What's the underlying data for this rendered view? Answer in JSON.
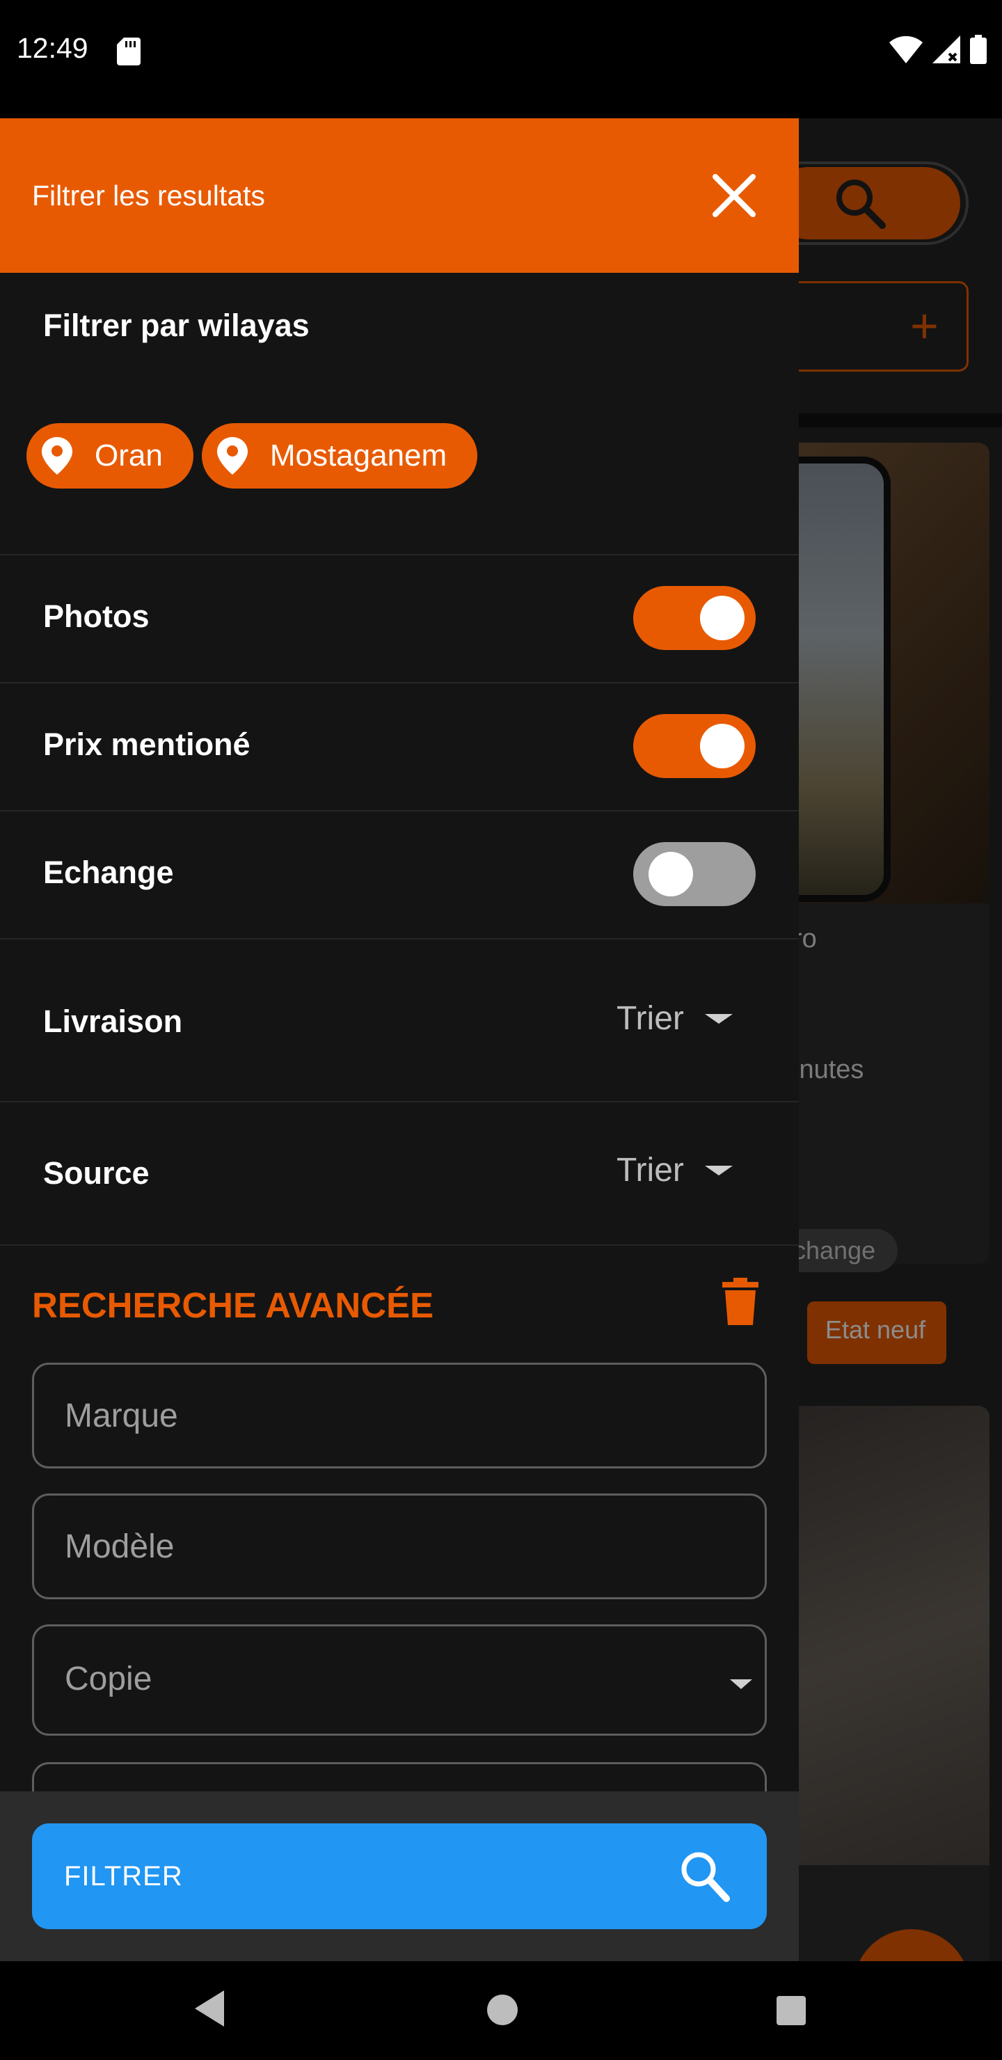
{
  "status_bar": {
    "time": "12:49"
  },
  "background": {
    "card_title_fragment": "ro",
    "time_fragment": "inutes",
    "chip_fragment": "change",
    "condition_badge": "Etat neuf",
    "ellipsis": ", ..."
  },
  "drawer": {
    "title": "Filtrer les resultats",
    "wilaya_heading": "Filtrer par wilayas",
    "wilayas": [
      "Oran",
      "Mostaganem"
    ],
    "toggles": [
      {
        "label": "Photos",
        "on": true
      },
      {
        "label": "Prix mentioné",
        "on": true
      },
      {
        "label": "Echange",
        "on": false
      }
    ],
    "sort_rows": [
      {
        "label": "Livraison",
        "value": "Trier"
      },
      {
        "label": "Source",
        "value": "Trier"
      }
    ],
    "advanced": {
      "title": "RECHERCHE AVANCÉE",
      "brand_placeholder": "Marque",
      "model_placeholder": "Modèle",
      "copy_select": "Copie"
    },
    "filter_button": "FILTRER"
  },
  "colors": {
    "accent": "#e85a02",
    "primary_button": "#2196f3",
    "drawer_bg": "#141414"
  },
  "icons": [
    "sd-card-icon",
    "wifi-icon",
    "signal-icon",
    "battery-icon",
    "close-icon",
    "location-pin-icon",
    "trash-icon",
    "search-icon",
    "back-icon",
    "home-icon",
    "recents-icon"
  ]
}
